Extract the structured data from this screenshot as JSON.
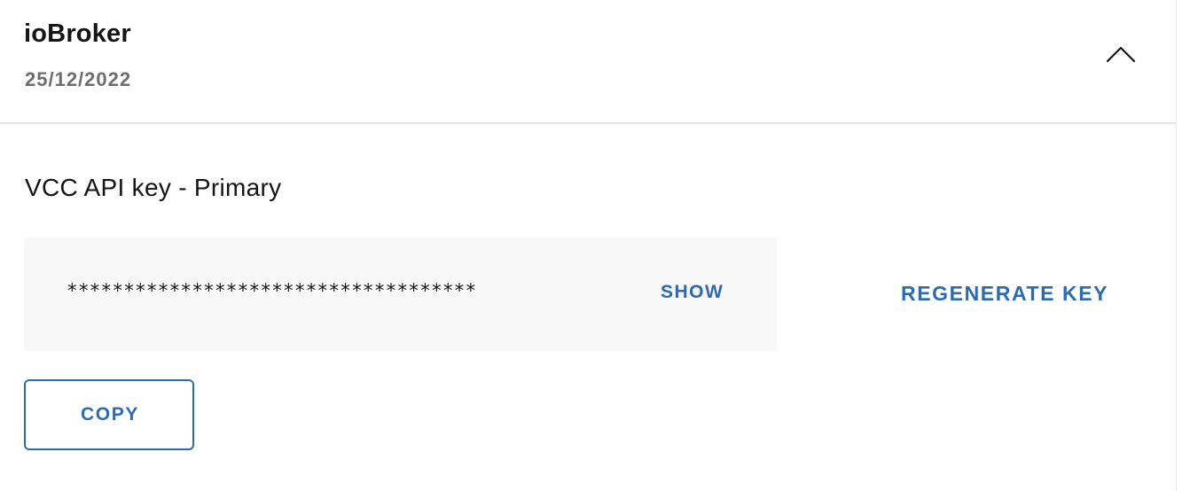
{
  "header": {
    "title": "ioBroker",
    "date": "25/12/2022",
    "toggle_icon": "chevron-up-icon"
  },
  "api_key": {
    "label": "VCC API key - Primary",
    "masked_value": "************************************",
    "show_label": "SHOW",
    "regenerate_label": "REGENERATE KEY",
    "copy_label": "COPY"
  },
  "colors": {
    "accent": "#2c6bb0",
    "text": "#141414",
    "muted": "#6e6e6e",
    "key_box_bg": "#f8f8f8",
    "divider": "#e6e6e6"
  }
}
